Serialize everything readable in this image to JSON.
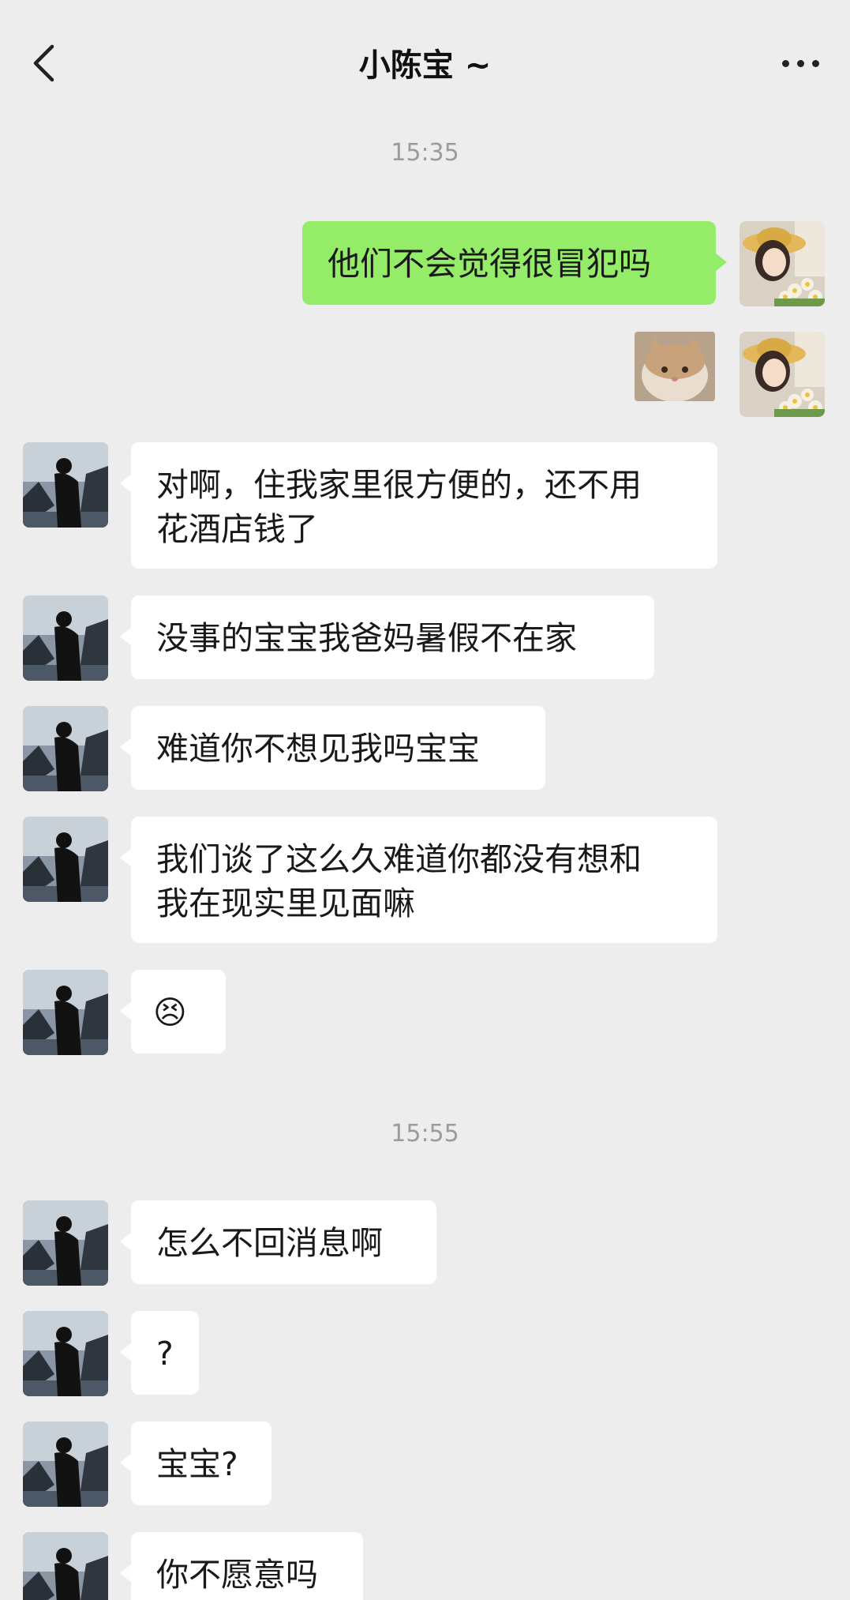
{
  "header": {
    "title": "小陈宝 ~",
    "back_icon": "chevron-left-icon",
    "more_icon": "more-dots-icon"
  },
  "timestamps": [
    "15:35",
    "15:55"
  ],
  "messages": {
    "sent_1": "他们不会觉得很冒犯吗",
    "sent_2_sticker": "cat-sticker",
    "recv_1_line1": "对啊，住我家里很方便的，还不用",
    "recv_1_line2": "花酒店钱了",
    "recv_2": "没事的宝宝我爸妈暑假不在家",
    "recv_3": "难道你不想见我吗宝宝",
    "recv_4_line1": "我们谈了这么久难道你都没有想和",
    "recv_4_line2": "我在现实里见面嘛",
    "recv_5_emoji": "😣",
    "recv_6": "怎么不回消息啊",
    "recv_7": "?",
    "recv_8": "宝宝?",
    "recv_9": "你不愿意吗"
  },
  "colors": {
    "background": "#ededed",
    "sent_bubble": "#95ec69",
    "recv_bubble": "#ffffff",
    "time_text": "#9b9b9b"
  }
}
